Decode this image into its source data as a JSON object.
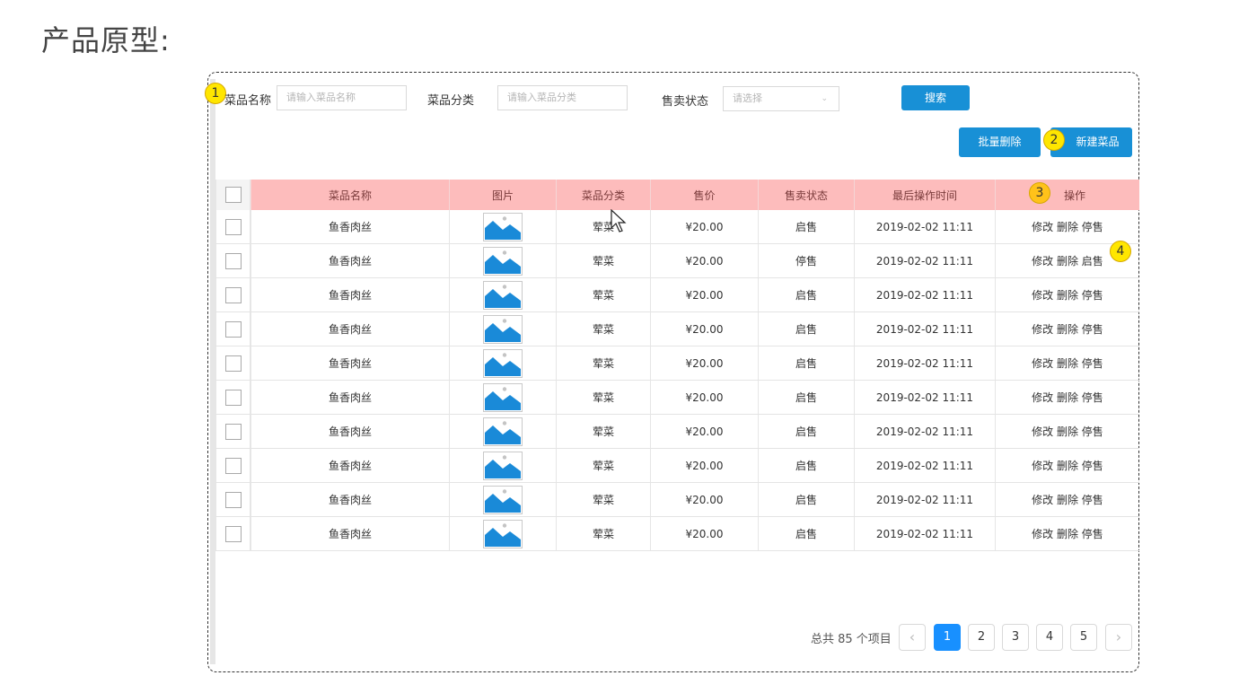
{
  "page_title": "产品原型:",
  "markers": [
    "1",
    "2",
    "3",
    "4"
  ],
  "search": {
    "name_label": "菜品名称",
    "name_placeholder": "请输入菜品名称",
    "category_label": "菜品分类",
    "category_placeholder": "请输入菜品分类",
    "status_label": "售卖状态",
    "status_placeholder": "请选择",
    "search_button": "搜索"
  },
  "actions": {
    "batch_delete": "批量删除",
    "new_dish": "新建菜品"
  },
  "table": {
    "headers": [
      "菜品名称",
      "图片",
      "菜品分类",
      "售价",
      "售卖状态",
      "最后操作时间",
      "操作"
    ],
    "rows": [
      {
        "name": "鱼香肉丝",
        "category": "荤菜",
        "price": "¥20.00",
        "status": "启售",
        "time": "2019-02-02 11:11",
        "ops": "修改 删除 停售"
      },
      {
        "name": "鱼香肉丝",
        "category": "荤菜",
        "price": "¥20.00",
        "status": "停售",
        "time": "2019-02-02 11:11",
        "ops": "修改 删除 启售"
      },
      {
        "name": "鱼香肉丝",
        "category": "荤菜",
        "price": "¥20.00",
        "status": "启售",
        "time": "2019-02-02 11:11",
        "ops": "修改 删除 停售"
      },
      {
        "name": "鱼香肉丝",
        "category": "荤菜",
        "price": "¥20.00",
        "status": "启售",
        "time": "2019-02-02 11:11",
        "ops": "修改 删除 停售"
      },
      {
        "name": "鱼香肉丝",
        "category": "荤菜",
        "price": "¥20.00",
        "status": "启售",
        "time": "2019-02-02 11:11",
        "ops": "修改 删除 停售"
      },
      {
        "name": "鱼香肉丝",
        "category": "荤菜",
        "price": "¥20.00",
        "status": "启售",
        "time": "2019-02-02 11:11",
        "ops": "修改 删除 停售"
      },
      {
        "name": "鱼香肉丝",
        "category": "荤菜",
        "price": "¥20.00",
        "status": "启售",
        "time": "2019-02-02 11:11",
        "ops": "修改 删除 停售"
      },
      {
        "name": "鱼香肉丝",
        "category": "荤菜",
        "price": "¥20.00",
        "status": "启售",
        "time": "2019-02-02 11:11",
        "ops": "修改 删除 停售"
      },
      {
        "name": "鱼香肉丝",
        "category": "荤菜",
        "price": "¥20.00",
        "status": "启售",
        "time": "2019-02-02 11:11",
        "ops": "修改 删除 停售"
      },
      {
        "name": "鱼香肉丝",
        "category": "荤菜",
        "price": "¥20.00",
        "status": "启售",
        "time": "2019-02-02 11:11",
        "ops": "修改 删除 停售"
      }
    ]
  },
  "pagination": {
    "total_text": "总共 85 个项目",
    "prev_icon": "‹",
    "next_icon": "›",
    "pages": [
      "1",
      "2",
      "3",
      "4",
      "5"
    ],
    "current": "1"
  },
  "colors": {
    "primary": "#1890d6",
    "header_bg": "#fdbcbc",
    "marker": "#ffe600"
  },
  "icons": {
    "image_placeholder": "image-thumbnail-icon",
    "cursor": "mouse-pointer-icon",
    "dropdown": "chevron-down-icon"
  }
}
